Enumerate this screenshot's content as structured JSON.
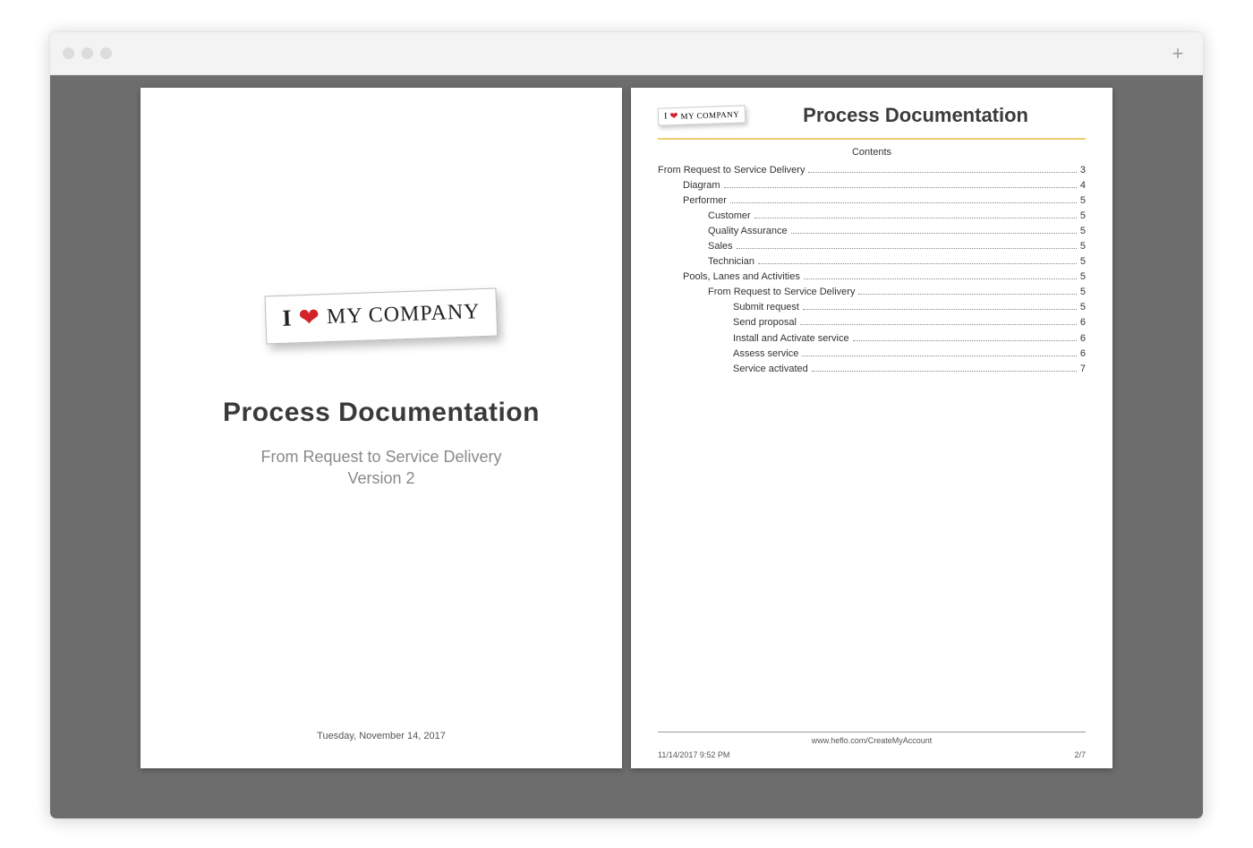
{
  "logo": {
    "prefix": "I",
    "heart": "❤",
    "text": "MY COMPANY"
  },
  "page1": {
    "title": "Process Documentation",
    "subtitle": "From Request to Service Delivery",
    "version": "Version 2",
    "date": "Tuesday, November 14, 2017"
  },
  "page2": {
    "header_title": "Process Documentation",
    "contents_label": "Contents",
    "toc": [
      {
        "label": "From Request to Service Delivery",
        "page": "3",
        "indent": 0
      },
      {
        "label": "Diagram",
        "page": "4",
        "indent": 1
      },
      {
        "label": "Performer",
        "page": "5",
        "indent": 1
      },
      {
        "label": "Customer",
        "page": "5",
        "indent": 2
      },
      {
        "label": "Quality Assurance",
        "page": "5",
        "indent": 2
      },
      {
        "label": "Sales",
        "page": "5",
        "indent": 2
      },
      {
        "label": "Technician",
        "page": "5",
        "indent": 2
      },
      {
        "label": "Pools, Lanes and Activities",
        "page": "5",
        "indent": 1
      },
      {
        "label": "From Request to Service Delivery",
        "page": "5",
        "indent": 2
      },
      {
        "label": "Submit request",
        "page": "5",
        "indent": 3
      },
      {
        "label": "Send proposal",
        "page": "6",
        "indent": 3
      },
      {
        "label": "Install and Activate service",
        "page": "6",
        "indent": 3
      },
      {
        "label": "Assess service",
        "page": "6",
        "indent": 3
      },
      {
        "label": "Service activated",
        "page": "7",
        "indent": 3
      }
    ],
    "footer_url": "www.heflo.com/CreateMyAccount",
    "footer_timestamp": "11/14/2017 9:52 PM",
    "footer_page": "2/7"
  }
}
